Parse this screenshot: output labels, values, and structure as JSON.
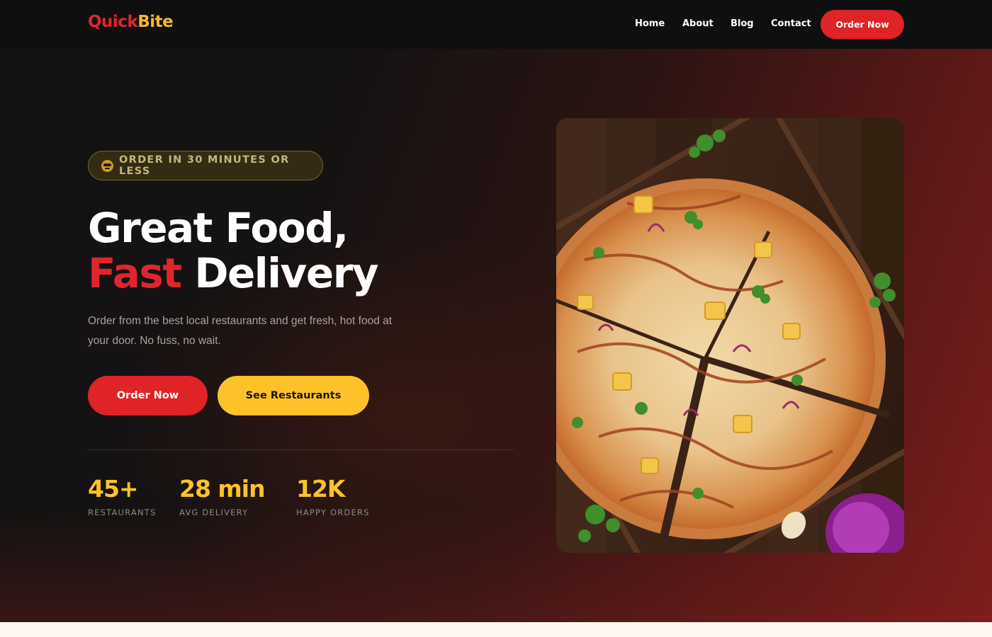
{
  "brand": {
    "part1": "Quick",
    "part2": "Bite"
  },
  "nav": {
    "links": [
      "Home",
      "About",
      "Blog",
      "Contact"
    ],
    "cta": "Order Now"
  },
  "hero": {
    "badge": "ORDER IN 30 MINUTES OR LESS",
    "headline_line1": "Great Food,",
    "headline_accent": "Fast",
    "headline_rest": "Delivery",
    "subtitle": "Order from the best local restaurants and get fresh, hot food at your door. No fuss, no wait.",
    "primary_button": "Order Now",
    "secondary_button": "See Restaurants",
    "stats": [
      {
        "value": "45+",
        "label": "RESTAURANTS"
      },
      {
        "value": "28 min",
        "label": "AVG DELIVERY"
      },
      {
        "value": "12K",
        "label": "HAPPY ORDERS"
      }
    ]
  },
  "colors": {
    "accent_red": "#df2327",
    "accent_yellow": "#fdc22a",
    "nav_bg": "#0f0f10"
  },
  "icons": {
    "badge_icon": "sunglasses-emoji-icon"
  }
}
